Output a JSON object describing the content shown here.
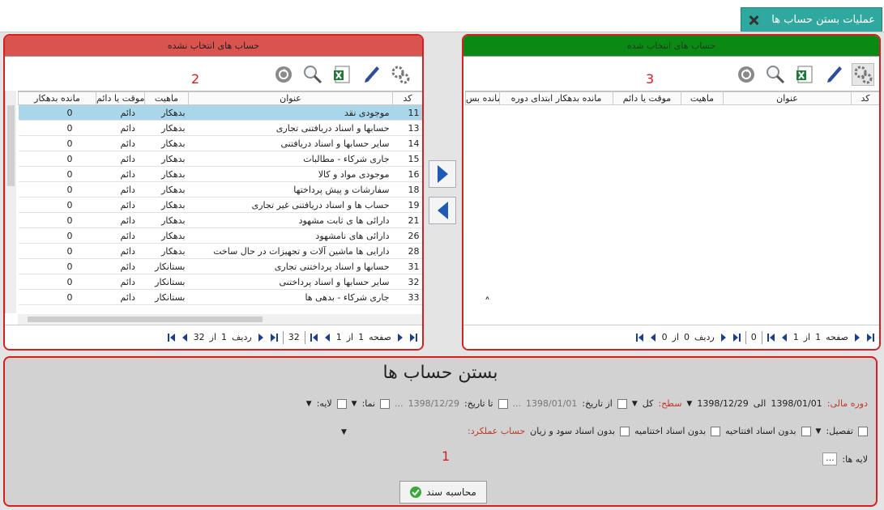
{
  "tab": {
    "title": "عملیات بستن حساب ها"
  },
  "left_panel": {
    "header": "حساب های انتخاب نشده",
    "marker": "2",
    "columns": [
      "کد",
      "عنوان",
      "ماهیت",
      "موقت یا دائم",
      "مانده بدهکار"
    ],
    "rows": [
      {
        "code": "11",
        "title": "موجودی نقد",
        "nature": "بدهکار",
        "temp": "دائم",
        "bal": "0"
      },
      {
        "code": "13",
        "title": "حسابها و اسناد دریافتنی تجاری",
        "nature": "بدهکار",
        "temp": "دائم",
        "bal": "0"
      },
      {
        "code": "14",
        "title": "سایر حسابها و اسناد دریافتنی",
        "nature": "بدهکار",
        "temp": "دائم",
        "bal": "0"
      },
      {
        "code": "15",
        "title": "جاری شرکاء - مطالبات",
        "nature": "بدهکار",
        "temp": "دائم",
        "bal": "0"
      },
      {
        "code": "16",
        "title": "موجودی مواد و کالا",
        "nature": "بدهکار",
        "temp": "دائم",
        "bal": "0"
      },
      {
        "code": "18",
        "title": "سفارشات و پیش پرداختها",
        "nature": "بدهکار",
        "temp": "دائم",
        "bal": "0"
      },
      {
        "code": "19",
        "title": "حساب ها و اسناد دریافتنی غیر تجاری",
        "nature": "بدهکار",
        "temp": "دائم",
        "bal": "0"
      },
      {
        "code": "21",
        "title": "دارائی ها ی ثابت مشهود",
        "nature": "بدهکار",
        "temp": "دائم",
        "bal": "0"
      },
      {
        "code": "26",
        "title": "دارائی های نامشهود",
        "nature": "بدهکار",
        "temp": "دائم",
        "bal": "0"
      },
      {
        "code": "28",
        "title": "دارایی ها ماشین آلات و تجهیزات در حال ساخت",
        "nature": "بدهکار",
        "temp": "دائم",
        "bal": "0"
      },
      {
        "code": "31",
        "title": "حسابها و اسناد پرداختنی تجاری",
        "nature": "بستانکار",
        "temp": "دائم",
        "bal": "0"
      },
      {
        "code": "32",
        "title": "سایر حسابها و اسناد پرداختنی",
        "nature": "بستانکار",
        "temp": "دائم",
        "bal": "0"
      },
      {
        "code": "33",
        "title": "جاری شرکاء - بدهی ها",
        "nature": "بستانکار",
        "temp": "دائم",
        "bal": "0"
      }
    ],
    "pager": {
      "page_word": "صفحه",
      "page": "1",
      "of_word": "از",
      "total_pages": "1",
      "count": "32",
      "row_word": "ردیف",
      "row": "1",
      "of_word2": "از",
      "total_rows": "32"
    }
  },
  "right_panel": {
    "header": "حساب های انتخاب شده",
    "marker": "3",
    "columns": [
      "کد",
      "عنوان",
      "ماهیت",
      "موقت یا دائم",
      "مانده بدهکار ابتدای دوره",
      "مانده بس"
    ],
    "pager": {
      "page_word": "صفحه",
      "page": "1",
      "of_word": "از",
      "total_pages": "1",
      "count": "0",
      "row_word": "ردیف",
      "row": "0",
      "of_word2": "از",
      "total_rows": "0"
    }
  },
  "bottom": {
    "title": "بستن حساب ها",
    "marker": "1",
    "fiscal_label": "دوره مالی:",
    "fiscal_from": "1398/01/01",
    "fiscal_to_word": "الی",
    "fiscal_to": "1398/12/29",
    "level_label": "سطح:",
    "level_value": "کل",
    "from_date_label": "از تاریخ:",
    "from_date_value": "1398/01/01",
    "to_date_label": "تا تاریخ:",
    "to_date_value": "1398/12/29",
    "nema_label": "نما:",
    "laye_label": "لایه:",
    "performance_label": "حساب عملکرد:",
    "opt_no_profit": "بدون اسناد سود و زیان",
    "opt_no_closing": "بدون اسناد اختتامیه",
    "opt_no_opening": "بدون اسناد افتتاحیه",
    "detail_label": "تفصیل:",
    "layers_label": "لایه ها:",
    "layers_btn": "...",
    "ellipsis": "...",
    "calc_button": "محاسبه سند"
  }
}
